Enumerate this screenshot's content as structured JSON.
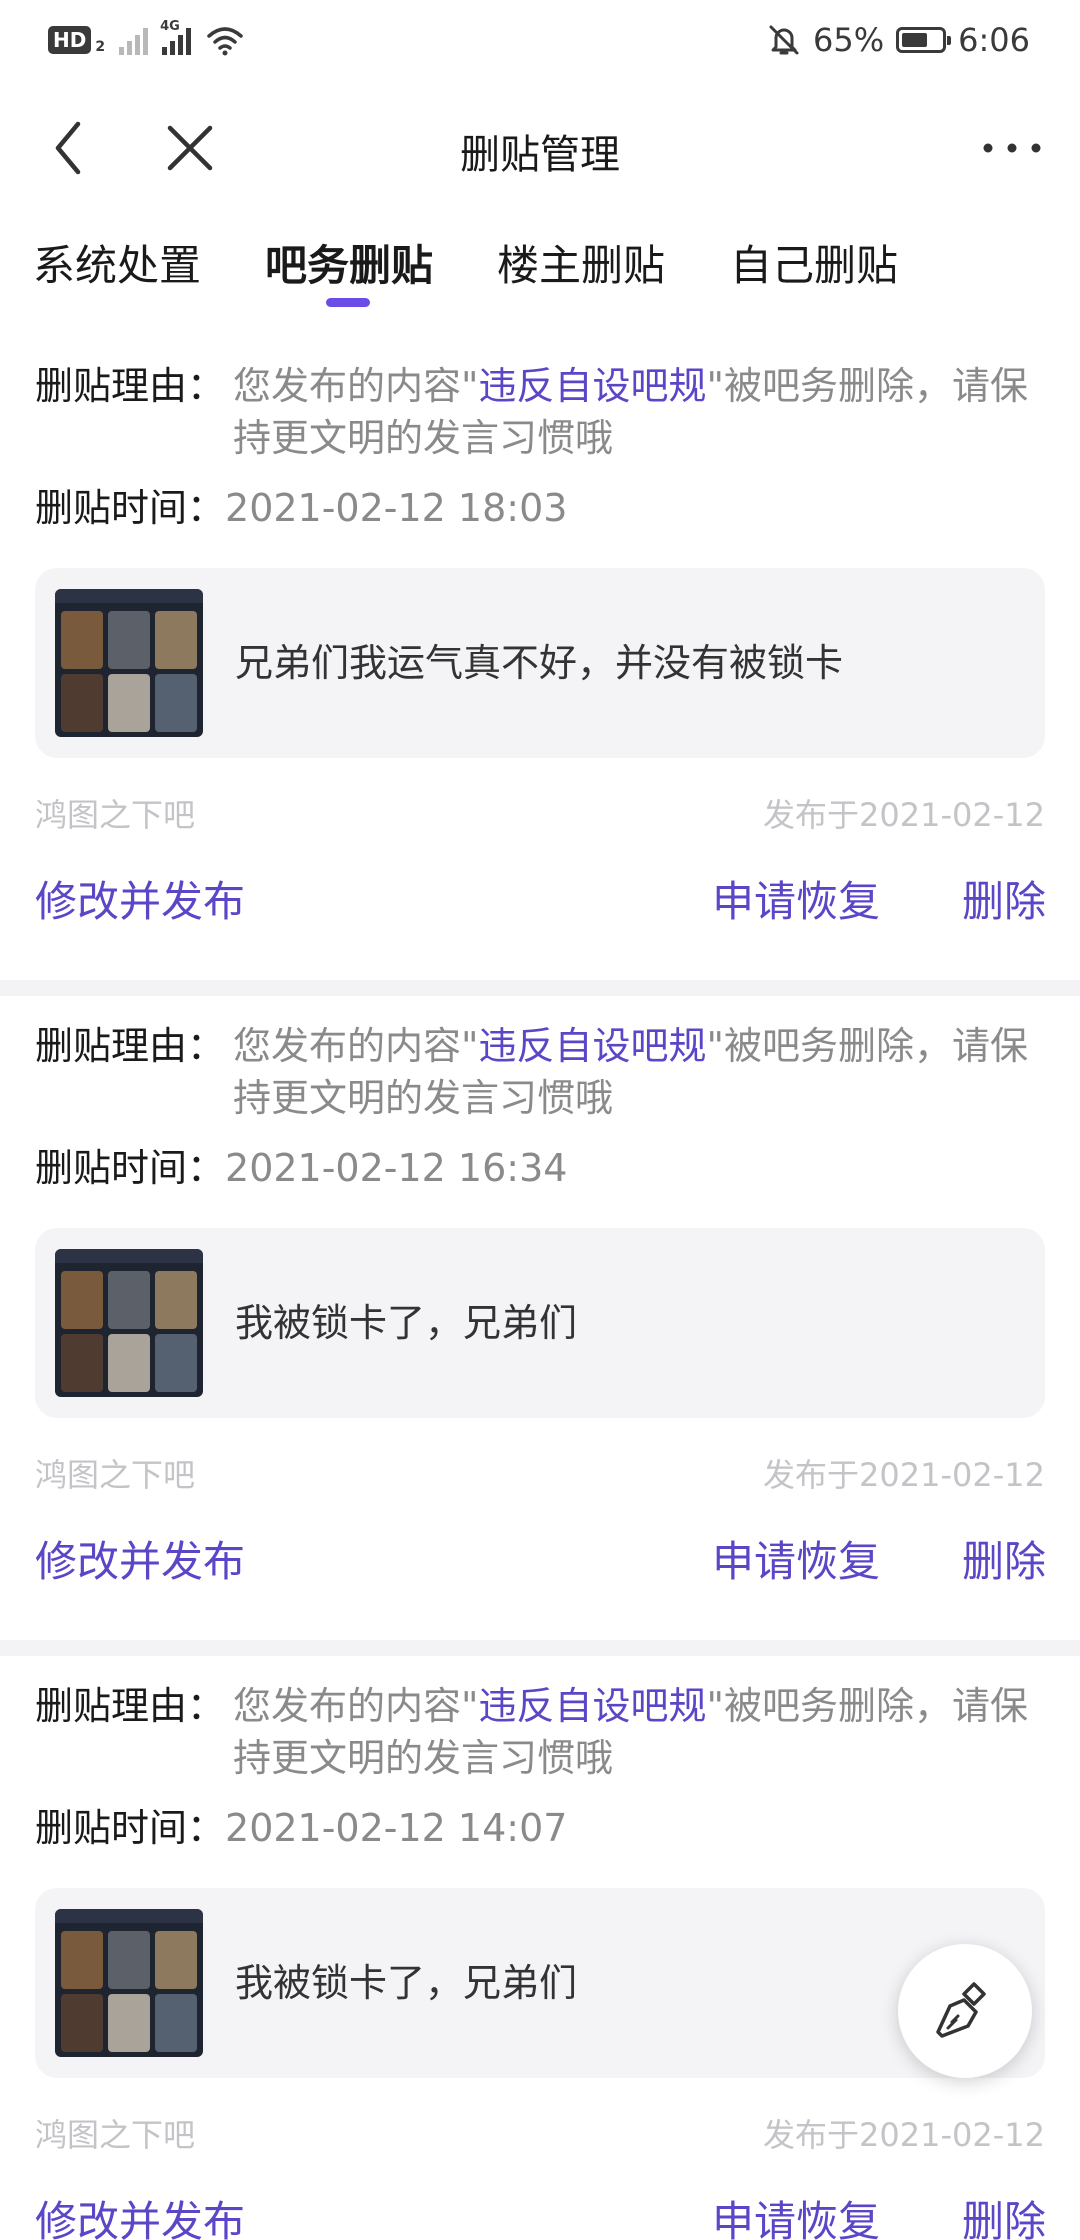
{
  "status_bar": {
    "hd_label": "HD",
    "hd_sub": "2",
    "network_type": "4G",
    "battery": "65%",
    "battery_level": 0.65,
    "time": "6:06"
  },
  "header": {
    "title": "删贴管理",
    "back_icon": "chevron-left-icon",
    "close_icon": "close-icon",
    "more_icon": "more-dots-icon"
  },
  "tabs": [
    {
      "label": "系统处置",
      "active": false
    },
    {
      "label": "吧务删贴",
      "active": true
    },
    {
      "label": "楼主删贴",
      "active": false
    },
    {
      "label": "自己删贴",
      "active": false
    }
  ],
  "labels": {
    "reason": "删贴理由：",
    "time": "删贴时间："
  },
  "posts": [
    {
      "reason_prefix": "您发布的内容\"",
      "reason_highlight": "违反自设吧规",
      "reason_suffix": "\"被吧务删除，请保持更文明的发言习惯哦",
      "time": "2021-02-12 18:03",
      "title": "兄弟们我运气真不好，并没有被锁卡",
      "forum": "鸿图之下吧",
      "published": "发布于2021-02-12",
      "edit_label": "修改并发布",
      "restore_label": "申请恢复",
      "delete_label": "删除"
    },
    {
      "reason_prefix": "您发布的内容\"",
      "reason_highlight": "违反自设吧规",
      "reason_suffix": "\"被吧务删除，请保持更文明的发言习惯哦",
      "time": "2021-02-12 16:34",
      "title": "我被锁卡了，兄弟们",
      "forum": "鸿图之下吧",
      "published": "发布于2021-02-12",
      "edit_label": "修改并发布",
      "restore_label": "申请恢复",
      "delete_label": "删除"
    },
    {
      "reason_prefix": "您发布的内容\"",
      "reason_highlight": "违反自设吧规",
      "reason_suffix": "\"被吧务删除，请保持更文明的发言习惯哦",
      "time": "2021-02-12 14:07",
      "title": "我被锁卡了，兄弟们",
      "forum": "鸿图之下吧",
      "published": "发布于2021-02-12",
      "edit_label": "修改并发布",
      "restore_label": "申请恢复",
      "delete_label": "删除"
    }
  ],
  "fab": {
    "icon": "broom-icon"
  },
  "colors": {
    "accent": "#6b4ce6",
    "link": "#5b46c8",
    "muted_text": "#8a8a8a",
    "faint_text": "#c4c4c8",
    "card_bg": "#f4f4f7"
  }
}
